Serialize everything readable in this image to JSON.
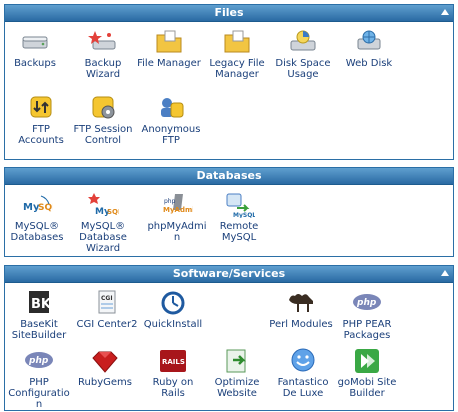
{
  "panels": {
    "files": {
      "title": "Files",
      "items": [
        {
          "label": "Backups",
          "icon": "backups-icon"
        },
        {
          "label": "Backup Wizard",
          "icon": "backup-wizard-icon"
        },
        {
          "label": "File Manager",
          "icon": "folder-icon"
        },
        {
          "label": "Legacy File Manager",
          "icon": "folder-icon"
        },
        {
          "label": "Disk Space Usage",
          "icon": "disk-usage-icon"
        },
        {
          "label": "Web Disk",
          "icon": "web-disk-icon"
        },
        {
          "label": "FTP Accounts",
          "icon": "ftp-arrows-icon"
        },
        {
          "label": "FTP Session Control",
          "icon": "ftp-gear-icon"
        },
        {
          "label": "Anonymous FTP",
          "icon": "anonymous-ftp-icon"
        }
      ]
    },
    "databases": {
      "title": "Databases",
      "items": [
        {
          "label": "MySQL® Databases",
          "icon": "mysql-icon"
        },
        {
          "label": "MySQL® Database Wizard",
          "icon": "mysql-wizard-icon"
        },
        {
          "label": "phpMyAdmin",
          "icon": "phpmyadmin-icon"
        },
        {
          "label": "Remote MySQL",
          "icon": "remote-mysql-icon"
        }
      ]
    },
    "software": {
      "title": "Software/Services",
      "items": [
        {
          "label": "BaseKit SiteBuilder",
          "icon": "basekit-icon"
        },
        {
          "label": "CGI Center2",
          "icon": "cgi-icon"
        },
        {
          "label": "QuickInstall",
          "icon": "quickinstall-icon"
        },
        {
          "label": "Perl Modules",
          "icon": "perl-camel-icon"
        },
        {
          "label": "PHP PEAR Packages",
          "icon": "php-icon"
        },
        {
          "label": "PHP Configuration",
          "icon": "php-icon"
        },
        {
          "label": "RubyGems",
          "icon": "rubygems-icon"
        },
        {
          "label": "Ruby on Rails",
          "icon": "rails-icon"
        },
        {
          "label": "Optimize Website",
          "icon": "optimize-icon"
        },
        {
          "label": "Fantastico De Luxe",
          "icon": "smiley-icon"
        },
        {
          "label": "goMobi Site Builder",
          "icon": "gomobi-icon"
        }
      ]
    }
  }
}
